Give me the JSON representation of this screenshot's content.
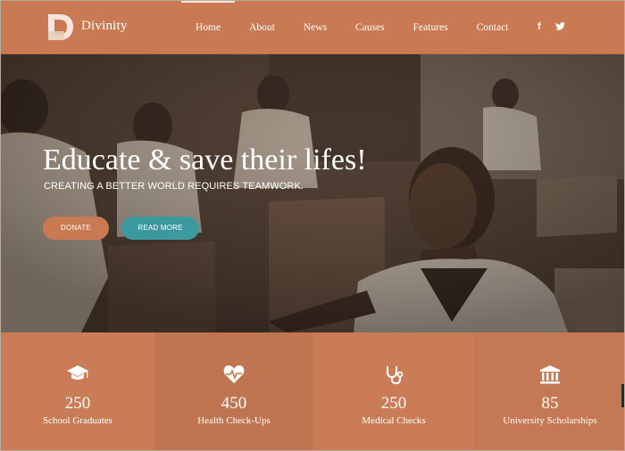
{
  "header": {
    "brand": "Divinity",
    "logo_letter": "D",
    "nav": [
      {
        "label": "Home",
        "active": true
      },
      {
        "label": "About"
      },
      {
        "label": "News"
      },
      {
        "label": "Causes"
      },
      {
        "label": "Features"
      },
      {
        "label": "Contact"
      }
    ],
    "social": {
      "facebook": "f",
      "twitter": "🐦"
    }
  },
  "hero": {
    "title": "Educate & save their lifes!",
    "subtitle": "CREATING A BETTER WORLD REQUIRES TEAMWORK.",
    "donate_label": "DONATE",
    "read_more_label": "READ MORE"
  },
  "stats": [
    {
      "icon": "graduation-cap-icon",
      "value": "250",
      "label": "School Graduates"
    },
    {
      "icon": "heartbeat-icon",
      "value": "450",
      "label": "Health Check-Ups"
    },
    {
      "icon": "stethoscope-icon",
      "value": "250",
      "label": "Medical Checks"
    },
    {
      "icon": "institution-icon",
      "value": "85",
      "label": "University Scholarships"
    }
  ],
  "colors": {
    "brand": "#c97a52",
    "accent": "#3c9a9f"
  }
}
